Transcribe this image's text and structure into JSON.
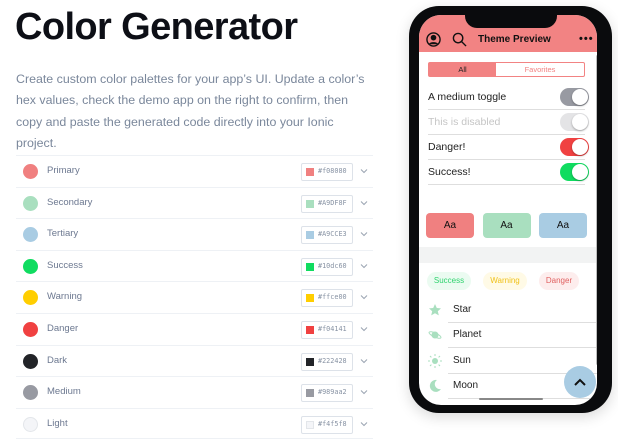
{
  "page": {
    "title": "Color Generator",
    "description": "Create custom color palettes for your app’s UI. Update a color’s hex values, check the demo app on the right to confirm, then copy and paste the generated code directly into your Ionic project."
  },
  "colors": [
    {
      "name": "Primary",
      "hex": "#f08080",
      "color": "#f08080"
    },
    {
      "name": "Secondary",
      "hex": "#A9DF8F",
      "color": "#a9dfbf"
    },
    {
      "name": "Tertiary",
      "hex": "#A9CCE3",
      "color": "#a9cce3"
    },
    {
      "name": "Success",
      "hex": "#10dc60",
      "color": "#10dc60"
    },
    {
      "name": "Warning",
      "hex": "#ffce00",
      "color": "#ffce00"
    },
    {
      "name": "Danger",
      "hex": "#f04141",
      "color": "#f04141"
    },
    {
      "name": "Dark",
      "hex": "#222428",
      "color": "#222428"
    },
    {
      "name": "Medium",
      "hex": "#989aa2",
      "color": "#989aa2"
    },
    {
      "name": "Light",
      "hex": "#f4f5f8",
      "color": "#f4f5f8"
    }
  ],
  "preview": {
    "title": "Theme Preview",
    "segments": [
      "All",
      "Favorites"
    ],
    "toggles": [
      {
        "label": "A medium toggle",
        "color": "#989aa2",
        "disabled": false
      },
      {
        "label": "This is disabled",
        "color": "#e4e4e6",
        "disabled": true
      },
      {
        "label": "Danger!",
        "color": "#f04141",
        "disabled": false
      },
      {
        "label": "Success!",
        "color": "#10dc60",
        "disabled": false
      }
    ],
    "buttons": [
      {
        "label": "Aa",
        "color": "#f08080"
      },
      {
        "label": "Aa",
        "color": "#a9dfbf"
      },
      {
        "label": "Aa",
        "color": "#a9cce3"
      }
    ],
    "chips": [
      {
        "label": "Success",
        "fg": "#2fd36e",
        "bg": "#ebfbf1"
      },
      {
        "label": "Warning",
        "fg": "#f0c21a",
        "bg": "#fffae6"
      },
      {
        "label": "Danger",
        "fg": "#e06060",
        "bg": "#fdeded"
      }
    ],
    "list": [
      {
        "label": "Star",
        "icon": "star-icon"
      },
      {
        "label": "Planet",
        "icon": "planet-icon"
      },
      {
        "label": "Sun",
        "icon": "sun-icon"
      },
      {
        "label": "Moon",
        "icon": "moon-icon"
      }
    ]
  }
}
